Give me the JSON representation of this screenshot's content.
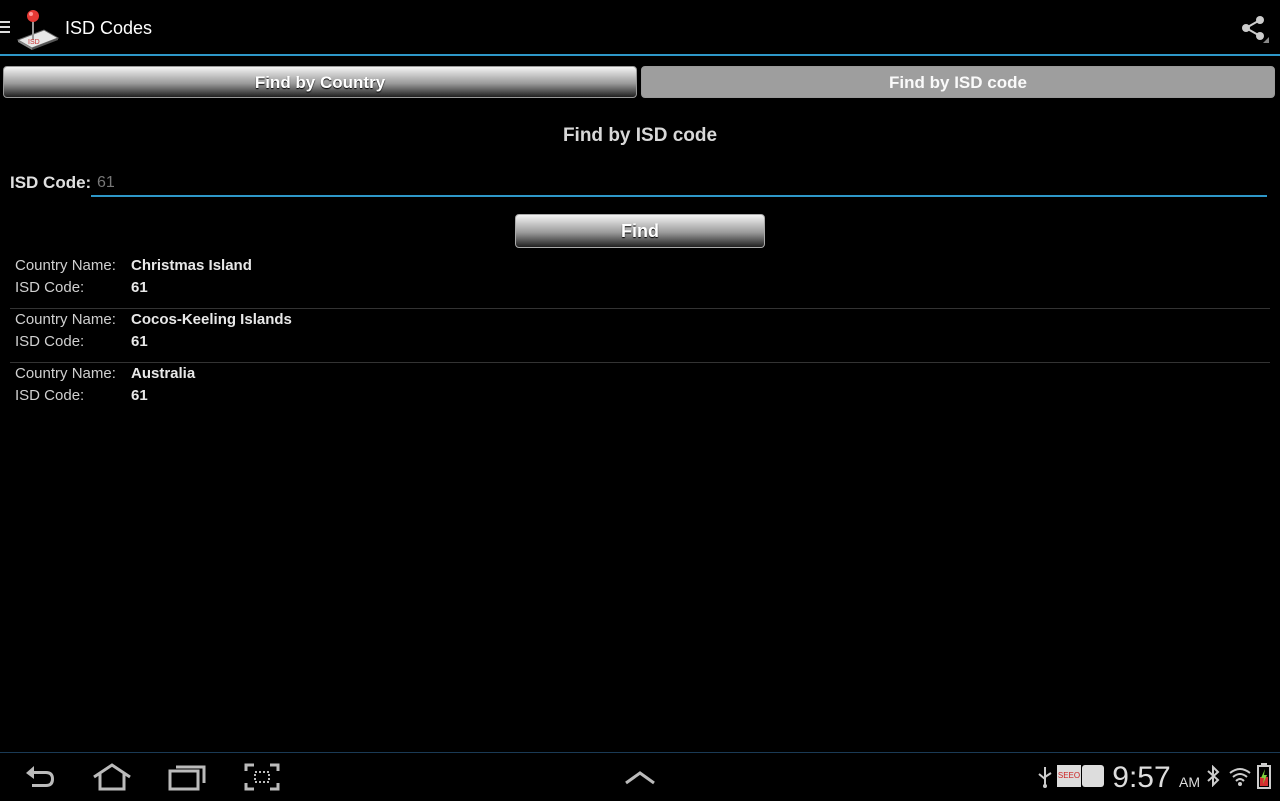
{
  "app": {
    "title": "ISD Codes"
  },
  "tabs": [
    {
      "label": "Find by Country"
    },
    {
      "label": "Find by ISD code"
    }
  ],
  "search": {
    "section_title": "Find by ISD code",
    "field_label": "ISD Code:",
    "value": "61",
    "button_label": "Find"
  },
  "results": [
    {
      "name_label": "Country Name:",
      "name": "Christmas Island",
      "code_label": "ISD Code:",
      "code": "61"
    },
    {
      "name_label": "Country Name:",
      "name": "Cocos-Keeling Islands",
      "code_label": "ISD Code:",
      "code": "61"
    },
    {
      "name_label": "Country Name:",
      "name": "Australia",
      "code_label": "ISD Code:",
      "code": "61"
    }
  ],
  "system": {
    "time": "9:57",
    "ampm": "AM",
    "notification_badge": "SEEO"
  },
  "colors": {
    "accent": "#2e97c8"
  },
  "icons": [
    "menu-icon",
    "app-icon",
    "share-icon",
    "back-icon",
    "home-icon",
    "recent-apps-icon",
    "screenshot-icon",
    "up-arrow-icon",
    "usb-icon",
    "bluetooth-icon",
    "wifi-icon",
    "battery-icon"
  ]
}
